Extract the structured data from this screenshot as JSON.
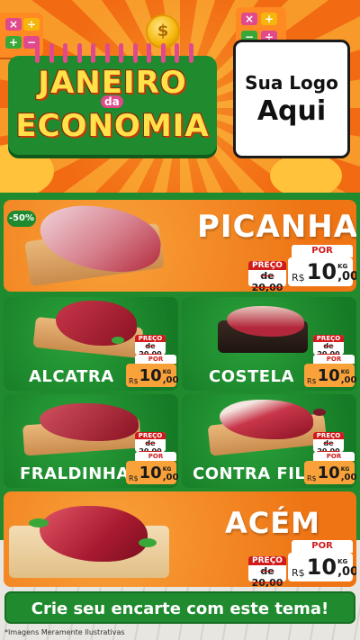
{
  "header": {
    "title_line1": "JANEIRO",
    "title_connector": "da",
    "title_line2": "ECONOMIA",
    "logo_line1": "Sua Logo",
    "logo_line2": "Aqui"
  },
  "colors": {
    "orange": "#f26b12",
    "green": "#1f8a2e",
    "red": "#d11b1b",
    "yellow": "#ffe14a"
  },
  "featured": {
    "badge": "-50%",
    "name": "PICANHA",
    "old_label": "PREÇO",
    "old_value": "de 20,00",
    "por_label": "POR",
    "currency": "R$",
    "price_int": "10",
    "price_dec": ",00",
    "unit": "KG"
  },
  "products": [
    {
      "name": "ALCATRA",
      "old_label": "PREÇO",
      "old_value": "de 20,00",
      "por_label": "POR",
      "currency": "R$",
      "price_int": "10",
      "price_dec": ",00",
      "unit": "KG"
    },
    {
      "name": "COSTELA",
      "old_label": "PREÇO",
      "old_value": "de 20,00",
      "por_label": "POR",
      "currency": "R$",
      "price_int": "10",
      "price_dec": ",00",
      "unit": "KG"
    },
    {
      "name": "FRALDINHA",
      "old_label": "PREÇO",
      "old_value": "de 20,00",
      "por_label": "POR",
      "currency": "R$",
      "price_int": "10",
      "price_dec": ",00",
      "unit": "KG"
    },
    {
      "name": "CONTRA FILÉ",
      "old_label": "PREÇO",
      "old_value": "de 20,00",
      "por_label": "POR",
      "currency": "R$",
      "price_int": "10",
      "price_dec": ",00",
      "unit": "KG"
    }
  ],
  "bottom_product": {
    "name": "ACÉM",
    "old_label": "PREÇO",
    "old_value": "de 20,00",
    "por_label": "POR",
    "currency": "R$",
    "price_int": "10",
    "price_dec": ",00",
    "unit": "KG"
  },
  "footer": {
    "cta": "Crie seu encarte com este tema!",
    "disclaimer": "*Imagens Meramente Ilustrativas"
  }
}
